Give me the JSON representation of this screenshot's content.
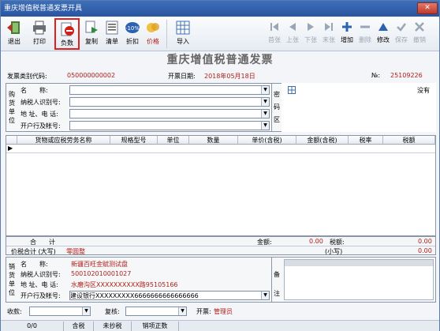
{
  "window": {
    "title": "重庆增值税普通发票开具",
    "close": "✕"
  },
  "toolbar": {
    "exit": "退出",
    "print": "打印",
    "negative": "负数",
    "copy": "复制",
    "list": "清单",
    "discount": "折扣",
    "price": "价格",
    "import": "导入",
    "first": "首张",
    "prev": "上张",
    "next": "下张",
    "last": "末张",
    "add": "增加",
    "delete": "删除",
    "modify": "修改",
    "save": "保存",
    "cancel": "撤销"
  },
  "invoice": {
    "title": "重庆增值税普通发票",
    "code_label": "发票类别代码:",
    "code": "050000000002",
    "date_label": "开票日期:",
    "date": "2018年05月18日",
    "no_label": "№:",
    "no": "25109226"
  },
  "buyer": {
    "section": [
      "购",
      "货",
      "单",
      "位"
    ],
    "name_label": "名　　称:",
    "tax_label": "纳税人识别号:",
    "addr_label": "地 址、电 话:",
    "bank_label": "开户行及帐号:",
    "name": "",
    "tax": "",
    "addr": "",
    "bank": ""
  },
  "secret": {
    "label": [
      "密",
      "码",
      "区"
    ],
    "status": "没有"
  },
  "grid": {
    "columns": [
      "货物或应税劳务名称",
      "规格型号",
      "单位",
      "数量",
      "单价(含税)",
      "金额(含税)",
      "税率",
      "税额"
    ]
  },
  "totals": {
    "sum_label": "合　　计",
    "amount_label": "金额:",
    "amount": "0.00",
    "tax_label": "税额:",
    "tax": "0.00",
    "cap_label": "价税合计 (大写)",
    "cap": "零圆整",
    "small_label": "(小写)",
    "small": "0.00"
  },
  "seller": {
    "section": [
      "销",
      "货",
      "单",
      "位"
    ],
    "name_label": "名　　称:",
    "name": "新疆百旺金赋测试盘",
    "tax_label": "纳税人识别号:",
    "tax": "500102010001027",
    "addr_label": "地 址、电 话:",
    "addr": "水磨沟区XXXXXXXXXX路95105166",
    "bank_label": "开户行及帐号:",
    "bank": "建设银行XXXXXXXXX6666666666666666"
  },
  "remark": [
    "备",
    "注"
  ],
  "signature": {
    "payee_label": "收款:",
    "review_label": "复核:",
    "issuer_label": "开票:",
    "issuer": "管理员"
  },
  "status": {
    "count": "0/0",
    "tax_included": "含税",
    "not_copied": "未抄税",
    "sale_invoice": "销项正数"
  }
}
